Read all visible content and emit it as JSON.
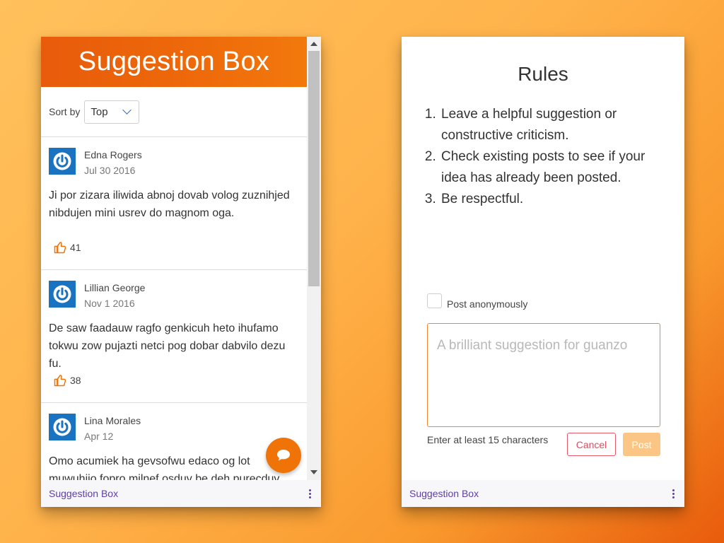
{
  "left": {
    "header_title": "Suggestion Box",
    "sort_label": "Sort by",
    "sort_value": "Top",
    "posts": [
      {
        "author": "Edna Rogers",
        "date": "Jul 30 2016",
        "body": "Ji por zizara iliwida abnoj dovab volog zuznihjed nibdujen mini usrev do magnom oga.",
        "likes": "41"
      },
      {
        "author": "Lillian George",
        "date": "Nov 1 2016",
        "body": "De saw faadauw ragfo genkicuh heto ihufamo tokwu zow pujazti netci pog dobar dabvilo dezu fu.",
        "likes": "38"
      },
      {
        "author": "Lina Morales",
        "date": "Apr 12",
        "body": "Omo acumiek ha gevsofwu edaco og lot muwuhijo fopro milnef osduv be deh purecduv",
        "likes": ""
      }
    ],
    "footer_title": "Suggestion Box"
  },
  "right": {
    "rules_title": "Rules",
    "rules": [
      "Leave a helpful suggestion or constructive criticism.",
      "Check existing posts to see if your idea has already been posted.",
      "Be respectful."
    ],
    "anonymous_label": "Post anonymously",
    "textarea_placeholder": "A brilliant suggestion for guanzo",
    "hint": "Enter at least 15 characters",
    "cancel_label": "Cancel",
    "post_label": "Post",
    "footer_title": "Suggestion Box"
  },
  "colors": {
    "accent": "#ef7307",
    "footer_text": "#5e3fa6",
    "cancel": "#e04a5e"
  },
  "icons": {
    "avatar": "power-icon",
    "like": "thumbs-up-icon",
    "fab": "chat-bubble-icon",
    "menu": "more-vertical-icon",
    "sort": "chevron-down-icon"
  }
}
